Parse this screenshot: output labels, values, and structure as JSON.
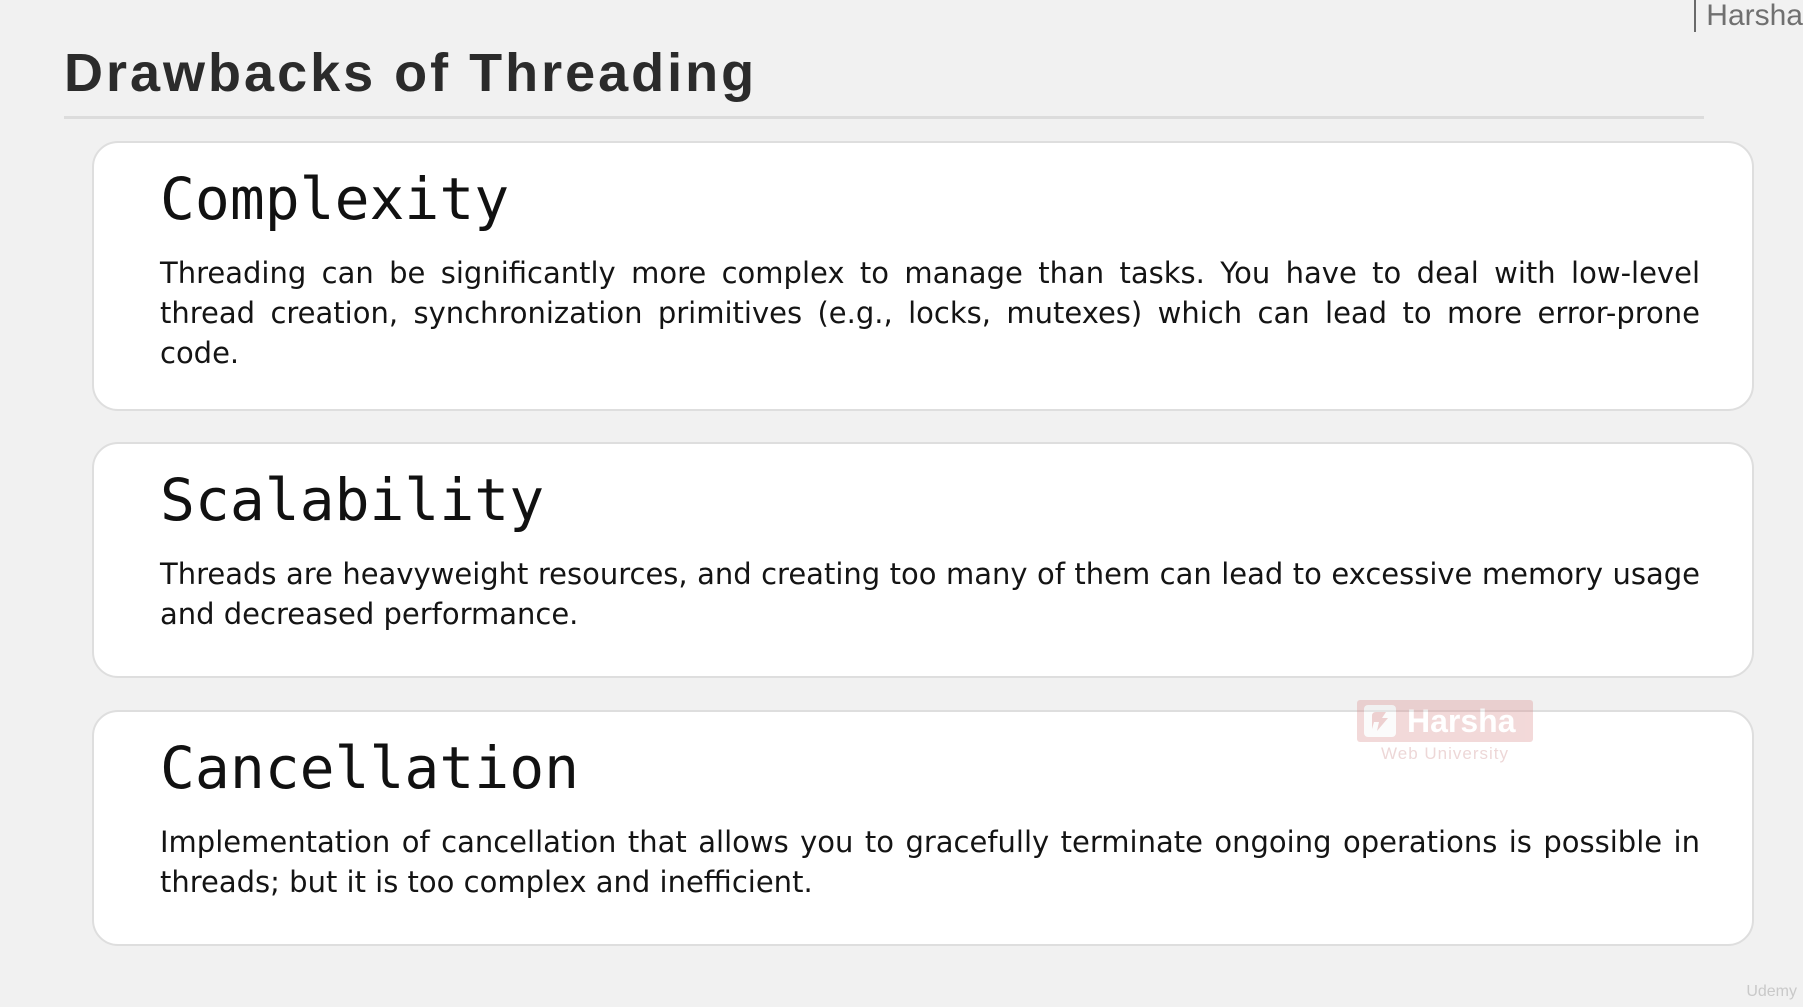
{
  "header": {
    "brand": "Harsha"
  },
  "slide": {
    "title": "Drawbacks of Threading"
  },
  "cards": [
    {
      "heading": "Complexity",
      "body": "Threading can be significantly more complex to manage than tasks. You have to deal with low-level thread creation, synchronization primitives (e.g., locks, mutexes) which can lead to more error-prone code."
    },
    {
      "heading": "Scalability",
      "body": "Threads are heavyweight resources, and creating too many of them can lead to excessive memory usage and decreased performance."
    },
    {
      "heading": "Cancellation",
      "body": "Implementation of cancellation that allows you to gracefully terminate ongoing operations is possible in threads; but it is too complex and inefficient."
    }
  ],
  "watermark": {
    "name": "Harsha",
    "subtitle": "Web University"
  },
  "footer": {
    "platform": "Udemy"
  },
  "colors": {
    "background": "#f1f1f1",
    "card": "#ffffff",
    "card_border": "#dedede",
    "watermark": "#d98a8a"
  }
}
